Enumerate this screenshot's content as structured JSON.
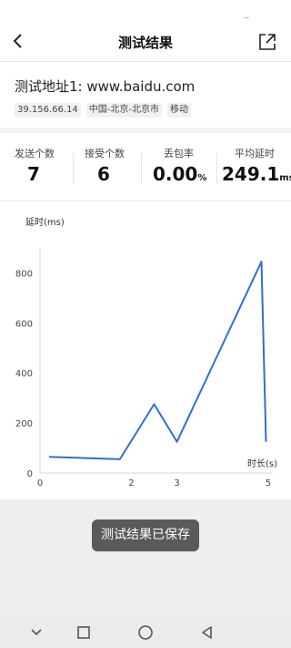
{
  "header": {
    "title": "测试结果",
    "back_icon": "back-arrow-icon",
    "share_icon": "share-export-icon"
  },
  "target": {
    "address": "测试地址1:  www.baidu.com",
    "tags": [
      "39.156.66.14",
      "中国-北京-北京市",
      "移动"
    ]
  },
  "stats": {
    "sent": {
      "label": "发送个数",
      "value": "7"
    },
    "received": {
      "label": "接受个数",
      "value": "6"
    },
    "loss": {
      "label": "丢包率",
      "value": "0.00",
      "unit": "%"
    },
    "latency": {
      "label": "平均延时",
      "value": "249.1",
      "unit": "ms"
    }
  },
  "chart_data": {
    "type": "line",
    "ylabel": "延时(ms)",
    "xlabel": "时长(s)",
    "x": [
      0.2,
      1.75,
      2.5,
      3.0,
      4.85,
      4.95
    ],
    "y": [
      65,
      55,
      275,
      125,
      845,
      125
    ],
    "xlim": [
      0,
      5.1
    ],
    "ylim": [
      0,
      900
    ],
    "xticks": [
      0,
      2,
      3,
      5
    ],
    "yticks": [
      0,
      200,
      400,
      600,
      800
    ],
    "line_color": "#2f6fd6",
    "grid": false
  },
  "toast": {
    "text": "测试结果已保存"
  },
  "navbar": {
    "icons": [
      "nav-collapse-icon",
      "nav-recents-icon",
      "nav-home-icon",
      "nav-back-icon"
    ]
  }
}
